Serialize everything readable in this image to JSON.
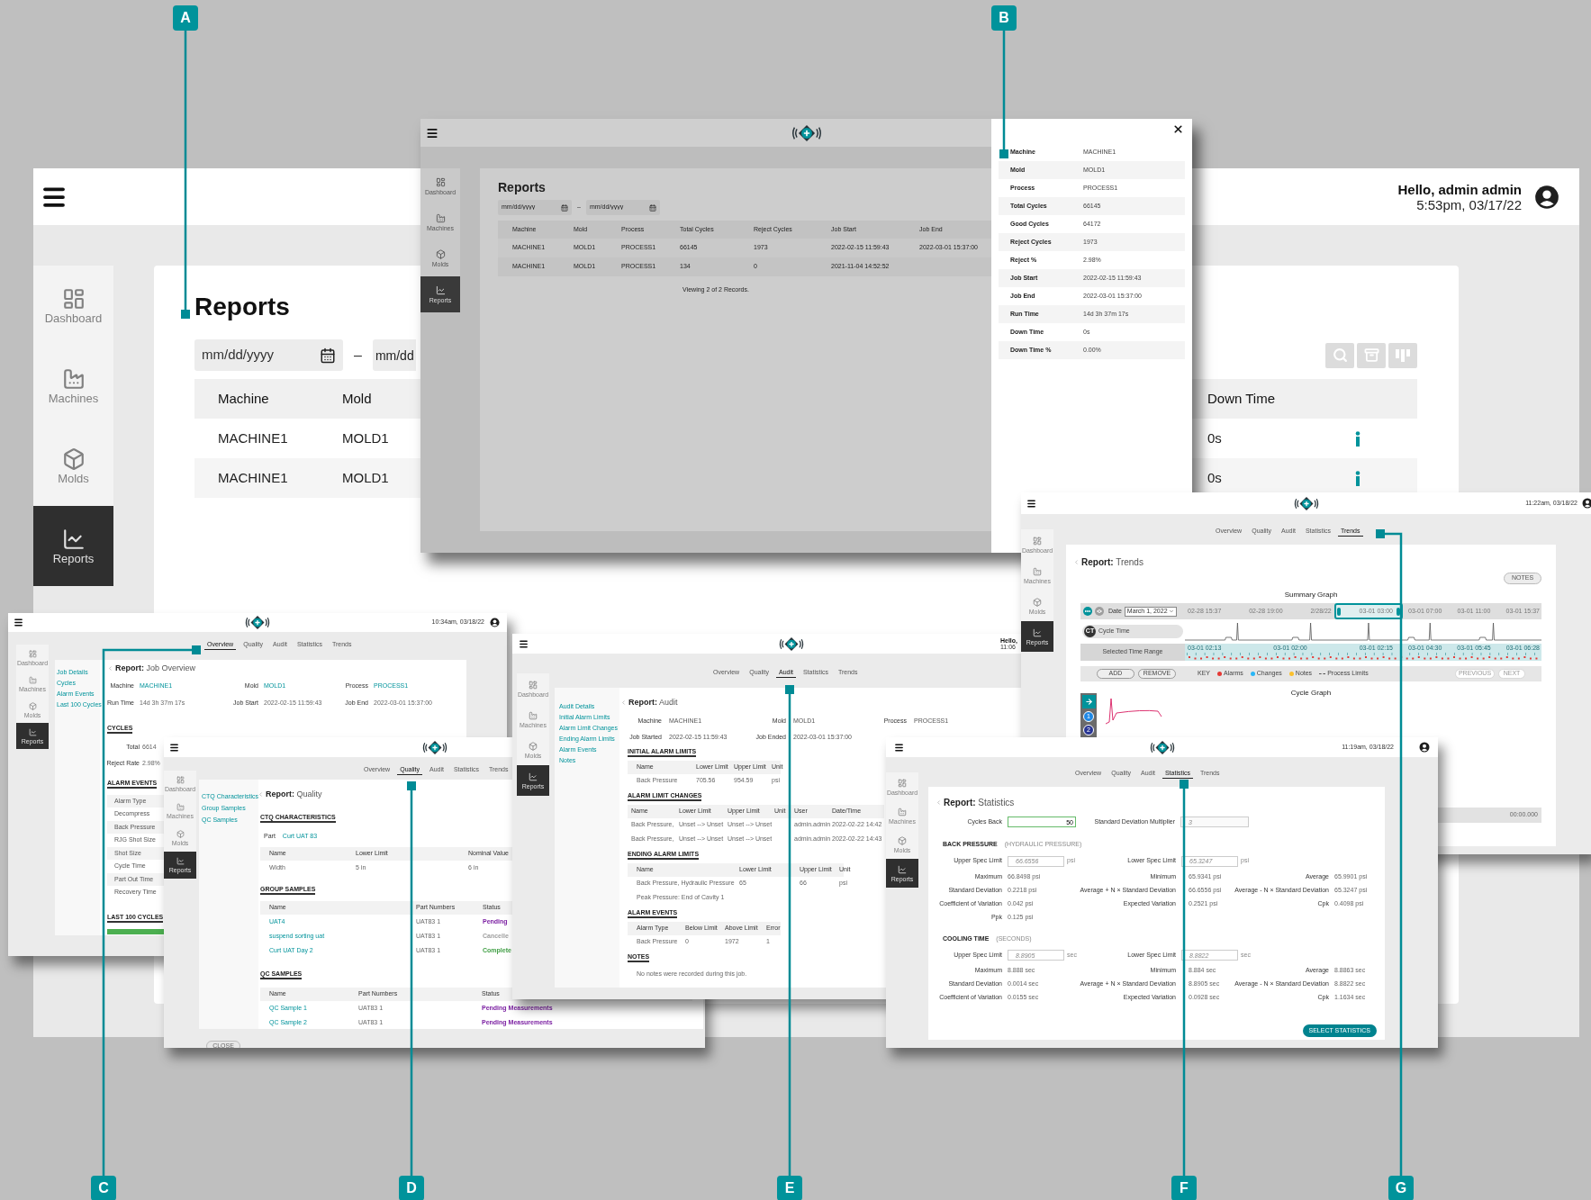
{
  "callouts": [
    {
      "label": "A"
    },
    {
      "label": "B"
    },
    {
      "label": "C"
    },
    {
      "label": "D"
    },
    {
      "label": "E"
    },
    {
      "label": "F"
    },
    {
      "label": "G"
    }
  ],
  "reports_window": {
    "greeting": "Hello, admin admin",
    "datetime": "5:53pm, 03/17/22",
    "sidebar": [
      {
        "label": "Dashboard",
        "selected": false
      },
      {
        "label": "Machines",
        "selected": false
      },
      {
        "label": "Molds",
        "selected": false
      },
      {
        "label": "Reports",
        "selected": true
      }
    ],
    "title": "Reports",
    "date_from": {
      "placeholder": "mm/dd/yyyy"
    },
    "date_separator": "–",
    "date_to": {
      "placeholder": "mm/dd"
    },
    "columns": [
      "Machine",
      "Mold",
      "Down Time"
    ],
    "rows": [
      {
        "cells": [
          "MACHINE1",
          "MOLD1",
          "0s"
        ]
      },
      {
        "cells": [
          "MACHINE1",
          "MOLD1",
          "0s"
        ]
      }
    ]
  },
  "details_window": {
    "sidebar": [
      {
        "label": "Dashboard",
        "selected": false
      },
      {
        "label": "Machines",
        "selected": false
      },
      {
        "label": "Molds",
        "selected": false
      },
      {
        "label": "Reports",
        "selected": true
      }
    ],
    "title": "Reports",
    "date_from": {
      "placeholder": "mm/dd/yyyy"
    },
    "date_separator": "–",
    "date_to": {
      "placeholder": "mm/dd/yyyy"
    },
    "columns": [
      "Machine",
      "Mold",
      "Process",
      "Total Cycles",
      "Reject Cycles",
      "Job Start",
      "Job End"
    ],
    "rows": [
      {
        "cells": [
          "MACHINE1",
          "MOLD1",
          "PROCESS1",
          "66145",
          "1973",
          "2022-02-15 11:59:43",
          "2022-03-01 15:37:00"
        ]
      },
      {
        "cells": [
          "MACHINE1",
          "MOLD1",
          "PROCESS1",
          "134",
          "0",
          "2021-11-04 14:52:52"
        ]
      }
    ],
    "footer": "Viewing 2 of 2 Records.",
    "details": [
      {
        "label": "Machine",
        "value": "MACHINE1"
      },
      {
        "label": "Mold",
        "value": "MOLD1"
      },
      {
        "label": "Process",
        "value": "PROCESS1"
      },
      {
        "label": "Total Cycles",
        "value": "66145"
      },
      {
        "label": "Good Cycles",
        "value": "64172"
      },
      {
        "label": "Reject Cycles",
        "value": "1973"
      },
      {
        "label": "Reject %",
        "value": "2.98%"
      },
      {
        "label": "Job Start",
        "value": "2022-02-15 11:59:43"
      },
      {
        "label": "Job End",
        "value": "2022-03-01 15:37:00"
      },
      {
        "label": "Run Time",
        "value": "14d 3h 37m 17s"
      },
      {
        "label": "Down Time",
        "value": "0s"
      },
      {
        "label": "Down Time %",
        "value": "0.00%"
      }
    ]
  },
  "overview": {
    "datetime": "10:34am, 03/18/22",
    "sidebar": [
      {
        "label": "Dashboard",
        "selected": false
      },
      {
        "label": "Machines",
        "selected": false
      },
      {
        "label": "Molds",
        "selected": false
      },
      {
        "label": "Reports",
        "selected": true
      }
    ],
    "tabs": [
      {
        "label": "Overview",
        "selected": true
      },
      {
        "label": "Quality",
        "selected": false
      },
      {
        "label": "Audit",
        "selected": false
      },
      {
        "label": "Statistics",
        "selected": false
      },
      {
        "label": "Trends",
        "selected": false
      }
    ],
    "nav": [
      "Job Details",
      "Cycles",
      "Alarm Events",
      "Last 100 Cycles"
    ],
    "title_prefix": "Report:",
    "title": "Job Overview",
    "fields": [
      {
        "label": "Machine",
        "value": "MACHINE1",
        "link": true
      },
      {
        "label": "Mold",
        "value": "MOLD1",
        "link": true
      },
      {
        "label": "Process",
        "value": "PROCESS1",
        "link": true
      },
      {
        "label": "Run Time",
        "value": "14d 3h 37m 17s",
        "link": false
      },
      {
        "label": "Job Start",
        "value": "2022-02-15 11:59:43",
        "link": false
      },
      {
        "label": "Job End",
        "value": "2022-03-01 15:37:00",
        "link": false
      }
    ],
    "cycles_heading": "CYCLES",
    "cycles": [
      {
        "label": "Total",
        "value": "6614"
      },
      {
        "label": "Reject Rate",
        "value": "2.98%"
      }
    ],
    "alarm_heading": "ALARM EVENTS",
    "alarm_items": [
      "Alarm Type",
      "Decompress",
      "Back Pressure",
      "RJG Shot Size",
      "Shot Size",
      "Cycle Time",
      "Part Out Time",
      "Recovery Time"
    ],
    "last_heading": "LAST 100 CYCLES"
  },
  "quality": {
    "sidebar": [
      {
        "label": "Dashboard",
        "selected": false
      },
      {
        "label": "Machines",
        "selected": false
      },
      {
        "label": "Molds",
        "selected": false
      },
      {
        "label": "Reports",
        "selected": true
      }
    ],
    "tabs": [
      {
        "label": "Overview",
        "selected": false
      },
      {
        "label": "Quality",
        "selected": true
      },
      {
        "label": "Audit",
        "selected": false
      },
      {
        "label": "Statistics",
        "selected": false
      },
      {
        "label": "Trends",
        "selected": false
      }
    ],
    "nav": [
      "CTQ Characteristics",
      "Group Samples",
      "QC Samples"
    ],
    "title_prefix": "Report:",
    "title": "Quality",
    "ctq_heading": "CTQ CHARACTERISTICS",
    "part_label": "Part",
    "part_value": "Curt UAT 83",
    "ctq_columns": [
      "Name",
      "Lower Limit",
      "Nominal Value"
    ],
    "ctq_rows": [
      [
        "Width",
        "5 in",
        "6 in"
      ]
    ],
    "group_heading": "GROUP SAMPLES",
    "group_columns": [
      "Name",
      "Part Numbers",
      "Status"
    ],
    "group_rows": [
      {
        "name": "UAT4",
        "part_numbers": "UAT83 1",
        "status": "Pending",
        "color": "#7b1fa2"
      },
      {
        "name": "suspend sorting uat",
        "part_numbers": "UAT83 1",
        "status": "Cancelle",
        "color": "#9e9e9e"
      },
      {
        "name": "Curt UAT Day 2",
        "part_numbers": "UAT83 1",
        "status": "Complete",
        "color": "#43a047"
      }
    ],
    "qc_heading": "QC SAMPLES",
    "qc_columns": [
      "Name",
      "Part Numbers",
      "Status"
    ],
    "qc_rows": [
      {
        "name": "QC Sample 1",
        "part_numbers": "UAT83 1",
        "status": "Pending Measurements",
        "color": "#7b1fa2"
      },
      {
        "name": "QC Sample 2",
        "part_numbers": "UAT83 1",
        "status": "Pending Measurements",
        "color": "#7b1fa2"
      }
    ],
    "close_button": "CLOSE"
  },
  "audit": {
    "greeting": "Hello,",
    "time": "11:06",
    "sidebar": [
      {
        "label": "Dashboard",
        "selected": false
      },
      {
        "label": "Machines",
        "selected": false
      },
      {
        "label": "Molds",
        "selected": false
      },
      {
        "label": "Reports",
        "selected": true
      }
    ],
    "tabs": [
      {
        "label": "Overview",
        "selected": false
      },
      {
        "label": "Quality",
        "selected": false
      },
      {
        "label": "Audit",
        "selected": true
      },
      {
        "label": "Statistics",
        "selected": false
      },
      {
        "label": "Trends",
        "selected": false
      }
    ],
    "nav": [
      "Audit Details",
      "Initial Alarm Limits",
      "Alarm Limit Changes",
      "Ending Alarm Limits",
      "Alarm Events",
      "Notes"
    ],
    "title_prefix": "Report:",
    "title": "Audit",
    "fields": [
      {
        "label": "Machine",
        "value": "MACHINE1"
      },
      {
        "label": "Mold",
        "value": "MOLD1"
      },
      {
        "label": "Process",
        "value": "PROCESS1"
      },
      {
        "label": "Job Started",
        "value": "2022-02-15 11:59:43"
      },
      {
        "label": "Job Ended",
        "value": "2022-03-01 15:37:00"
      }
    ],
    "initial_heading": "INITIAL ALARM LIMITS",
    "initial_columns": [
      "Name",
      "Lower Limit",
      "Upper Limit",
      "Unit"
    ],
    "initial_rows": [
      {
        "name": "Back Pressure",
        "lower": "705.56",
        "upper": "954.59",
        "unit": "psi"
      }
    ],
    "changes_heading": "ALARM LIMIT CHANGES",
    "changes_columns": [
      "Name",
      "Lower Limit",
      "Upper Limit",
      "Unit",
      "User",
      "Date/Time"
    ],
    "changes_rows": [
      {
        "name": "Back Pressure,",
        "lower": "Unset --> Unset",
        "upper": "Unset --> Unset",
        "user": "admin.admin",
        "datetime": "2022-02-22 14:42"
      },
      {
        "name": "Back Pressure,",
        "lower": "Unset --> Unset",
        "upper": "Unset --> Unset",
        "user": "admin.admin",
        "datetime": "2022-02-22 14:43"
      }
    ],
    "ending_heading": "ENDING ALARM LIMITS",
    "ending_columns": [
      "Name",
      "Lower Limit",
      "Upper Limit",
      "Unit"
    ],
    "ending_rows": [
      {
        "name": "Back Pressure, Hydraulic Pressure",
        "lower": "65",
        "upper": "66",
        "unit": "psi"
      },
      {
        "name": "Peak Pressure: End of Cavity 1"
      }
    ],
    "events_heading": "ALARM EVENTS",
    "events_columns": [
      "Alarm Type",
      "Below Limit",
      "Above Limit",
      "Error"
    ],
    "events_rows": [
      {
        "name": "Back Pressure",
        "below": "0",
        "above": "1972",
        "error": "1"
      }
    ],
    "notes_heading": "NOTES",
    "notes_text": "No notes were recorded during this job."
  },
  "trends": {
    "datetime": "11:22am, 03/18/22",
    "sidebar": [
      {
        "label": "Dashboard",
        "selected": false
      },
      {
        "label": "Machines",
        "selected": false
      },
      {
        "label": "Molds",
        "selected": false
      },
      {
        "label": "Reports",
        "selected": true
      }
    ],
    "tabs": [
      {
        "label": "Overview",
        "selected": false
      },
      {
        "label": "Quality",
        "selected": false
      },
      {
        "label": "Audit",
        "selected": false
      },
      {
        "label": "Statistics",
        "selected": false
      },
      {
        "label": "Trends",
        "selected": true
      }
    ],
    "title_prefix": "Report:",
    "title": "Trends",
    "notes_button": "NOTES",
    "summary_title": "Summary Graph",
    "date_label": "Date",
    "date_value": "March 1, 2022",
    "axis_ticks": [
      "02-28 15:37",
      "02-28 19:00",
      "2/28/22",
      "03-01 03:00",
      "03-01 07:00",
      "03-01 11:00",
      "03-01 15:37"
    ],
    "series_badge": "CT",
    "series_label": "Cycle Time",
    "range_label": "Selected Time Range",
    "range_ticks": [
      "03-01 02:13",
      "03-01 02:00",
      "03-01 02:15",
      "03-01 04:30",
      "03-01 05:45",
      "03-01 06:28"
    ],
    "buttons": [
      {
        "label": "ADD",
        "disabled": false
      },
      {
        "label": "REMOVE",
        "disabled": false
      }
    ],
    "key_label": "KEY",
    "legend": [
      {
        "label": "Alarms",
        "kind": "dot",
        "color": "#e53935"
      },
      {
        "label": "Changes",
        "kind": "dot",
        "color": "#29b6f6"
      },
      {
        "label": "Notes",
        "kind": "dot",
        "color": "#fbc02d"
      },
      {
        "label": "Process Limits",
        "kind": "dashed"
      }
    ],
    "nav_buttons": [
      {
        "label": "PREVIOUS",
        "disabled": true
      },
      {
        "label": "NEXT",
        "disabled": true
      }
    ],
    "cycle_title": "Cycle Graph",
    "cycle_buttons": [
      "1",
      "2"
    ],
    "time_readout": "00:00.000"
  },
  "statistics": {
    "datetime": "11:19am, 03/18/22",
    "sidebar": [
      {
        "label": "Dashboard",
        "selected": false
      },
      {
        "label": "Machines",
        "selected": false
      },
      {
        "label": "Molds",
        "selected": false
      },
      {
        "label": "Reports",
        "selected": true
      }
    ],
    "tabs": [
      {
        "label": "Overview",
        "selected": false
      },
      {
        "label": "Quality",
        "selected": false
      },
      {
        "label": "Audit",
        "selected": false
      },
      {
        "label": "Statistics",
        "selected": true
      },
      {
        "label": "Trends",
        "selected": false
      }
    ],
    "title_prefix": "Report:",
    "title": "Statistics",
    "cycles_back_label": "Cycles Back",
    "cycles_back_value": "50",
    "multiplier_label": "Standard Deviation Multiplier",
    "multiplier_placeholder": "3",
    "sections": [
      {
        "heading": "BACK PRESSURE",
        "note": "(HYDRAULIC PRESSURE)",
        "limits": [
          {
            "label": "Upper Spec Limit",
            "placeholder": "66.6556",
            "unit": "psi"
          },
          {
            "label": "Lower Spec Limit",
            "placeholder": "65.3247",
            "unit": "psi"
          }
        ],
        "stats": [
          {
            "label": "Maximum",
            "value": "66.8498 psi"
          },
          {
            "label": "Minimum",
            "value": "65.9341 psi"
          },
          {
            "label": "Average",
            "value": "65.9901 psi"
          },
          {
            "label": "Standard Deviation",
            "value": "0.2218 psi"
          },
          {
            "label": "Average + N × Standard Deviation",
            "value": "66.6556 psi"
          },
          {
            "label": "Average - N × Standard Deviation",
            "value": "65.3247 psi"
          },
          {
            "label": "Coefficient of Variation",
            "value": "0.042 psi"
          },
          {
            "label": "Expected Variation",
            "value": "0.2521 psi"
          },
          {
            "label": "Cpk",
            "value": "0.4098 psi"
          },
          {
            "label": "Ppk",
            "value": "0.125 psi"
          }
        ]
      },
      {
        "heading": "COOLING TIME",
        "note": "(SECONDS)",
        "limits": [
          {
            "label": "Upper Spec Limit",
            "placeholder": "8.8905",
            "unit": "sec"
          },
          {
            "label": "Lower Spec Limit",
            "placeholder": "8.8822",
            "unit": "sec"
          }
        ],
        "stats": [
          {
            "label": "Maximum",
            "value": "8.888 sec"
          },
          {
            "label": "Minimum",
            "value": "8.884 sec"
          },
          {
            "label": "Average",
            "value": "8.8863 sec"
          },
          {
            "label": "Standard Deviation",
            "value": "0.0014 sec"
          },
          {
            "label": "Average + N × Standard Deviation",
            "value": "8.8905 sec"
          },
          {
            "label": "Average - N × Standard Deviation",
            "value": "8.8822 sec"
          },
          {
            "label": "Coefficient of Variation",
            "value": "0.0155 sec"
          },
          {
            "label": "Expected Variation",
            "value": "0.0928 sec"
          },
          {
            "label": "Cpk",
            "value": "1.1634 sec"
          }
        ]
      }
    ],
    "select_button": "SELECT STATISTICS"
  }
}
